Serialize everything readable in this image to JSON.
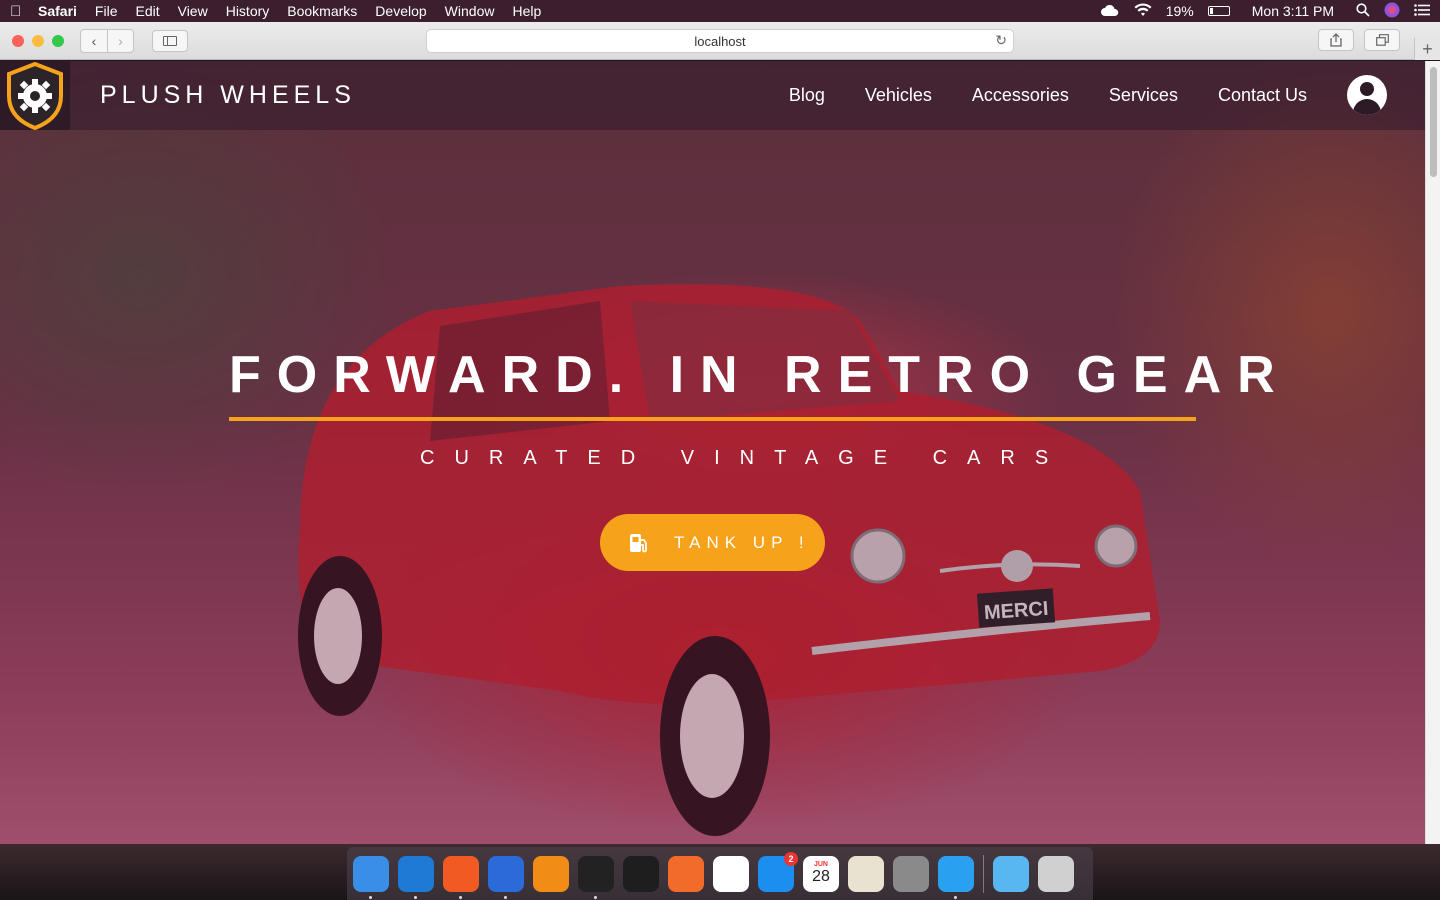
{
  "menubar": {
    "items": [
      "Safari",
      "File",
      "Edit",
      "View",
      "History",
      "Bookmarks",
      "Develop",
      "Window",
      "Help"
    ],
    "battery_percent": "19%",
    "battery_level": 0.19,
    "clock": "Mon 3:11 PM"
  },
  "browser": {
    "url": "localhost"
  },
  "site": {
    "brand": "PLUSH WHEELS",
    "nav": [
      "Blog",
      "Vehicles",
      "Accessories",
      "Services",
      "Contact Us"
    ],
    "hero_title": "FORWARD. IN RETRO GEAR",
    "hero_subtitle": "CURATED VINTAGE CARS",
    "cta_label": "TANK UP !",
    "accent_color": "#f7a21b",
    "car_plate": "MERCI"
  },
  "dock": {
    "apps": [
      {
        "name": "finder-icon",
        "color": "#3a8ee6"
      },
      {
        "name": "vscode-icon",
        "color": "#1f7ad6"
      },
      {
        "name": "brave-icon",
        "color": "#f25a24"
      },
      {
        "name": "wps-icon",
        "color": "#2b6bd9"
      },
      {
        "name": "vlc-icon",
        "color": "#f18d16"
      },
      {
        "name": "terminal-icon",
        "color": "#222222"
      },
      {
        "name": "figma-icon",
        "color": "#1e1e1e"
      },
      {
        "name": "sketch-icon",
        "color": "#f26b2a"
      },
      {
        "name": "mongodb-compass-icon",
        "color": "#ffffff"
      },
      {
        "name": "app-store-icon",
        "color": "#1c8ef0"
      },
      {
        "name": "calendar-icon",
        "color": "#ffffff"
      },
      {
        "name": "notes-icon",
        "color": "#e8e2d0"
      },
      {
        "name": "system-preferences-icon",
        "color": "#8a8a8a"
      },
      {
        "name": "safari-icon",
        "color": "#2aa0f0"
      },
      {
        "name": "downloads-folder-icon",
        "color": "#58b7f0"
      },
      {
        "name": "trash-icon",
        "color": "#d0d0d0"
      }
    ],
    "app_store_badge": "2",
    "calendar_month": "JUN",
    "calendar_day": "28"
  }
}
